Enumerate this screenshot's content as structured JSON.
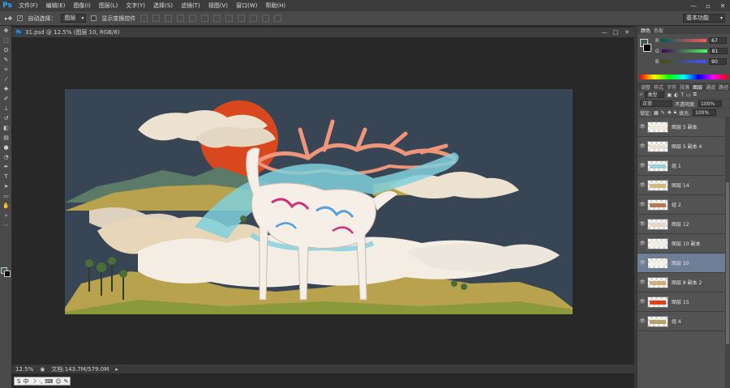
{
  "app": {
    "logo": "Ps"
  },
  "menu": [
    "文件(F)",
    "编辑(E)",
    "图像(I)",
    "图层(L)",
    "文字(Y)",
    "选择(S)",
    "滤镜(T)",
    "视图(V)",
    "窗口(W)",
    "帮助(H)"
  ],
  "options": {
    "auto_select_label": "自动选择：",
    "auto_select_value": "图层",
    "transform_label": "显示变换控件",
    "workspace": "基本功能"
  },
  "document": {
    "tab_title": "31.psd @ 12.5% (图层 10, RGB/8)",
    "zoom": "12.5%",
    "doc_info": "文档:143.7M/579.0M"
  },
  "ime": {
    "label": "中"
  },
  "panels": {
    "color_tabs": [
      "颜色",
      "色板"
    ],
    "rgb": [
      {
        "label": "R",
        "value": "67"
      },
      {
        "label": "G",
        "value": "81"
      },
      {
        "label": "B",
        "value": "90"
      }
    ],
    "layer_tabs": [
      "调整",
      "样式",
      "字符",
      "段落",
      "图层",
      "通道",
      "路径"
    ],
    "kind_label": "类型",
    "blend_mode": "正常",
    "opacity_label": "不透明度:",
    "opacity": "100%",
    "lock_label": "锁定:",
    "fill_label": "填充:",
    "fill": "100%"
  },
  "layers": [
    {
      "name": "图层 5 副本",
      "thumb_color": "#f1e7da",
      "selected": false
    },
    {
      "name": "图层 5 副本 4",
      "thumb_color": "#e8dfd2",
      "selected": false
    },
    {
      "name": "组 1",
      "thumb_color": "#9fd0d6",
      "selected": false
    },
    {
      "name": "图层 14",
      "thumb_color": "#d9b77a",
      "selected": false
    },
    {
      "name": "组 2",
      "thumb_color": "#b57b55",
      "selected": false
    },
    {
      "name": "图层 12",
      "thumb_color": "#e6d7c6",
      "selected": false
    },
    {
      "name": "图层 10 副本",
      "thumb_color": "#f3ece4",
      "selected": false
    },
    {
      "name": "图层 10",
      "thumb_color": "#f5f1ea",
      "selected": true
    },
    {
      "name": "图层 8 副本 2",
      "thumb_color": "#cfae7a",
      "selected": false
    },
    {
      "name": "图层 15",
      "thumb_color": "#e2401a",
      "selected": false
    },
    {
      "name": "组 4",
      "thumb_color": "#b8a164",
      "selected": false
    }
  ],
  "colors": {
    "canvas_bg": "#384555",
    "sun": "#d9471e",
    "antler": "#ef9579",
    "ribbon": "#7fd0dc",
    "land": "#b9a24d",
    "cloud": "#ede1cf"
  }
}
